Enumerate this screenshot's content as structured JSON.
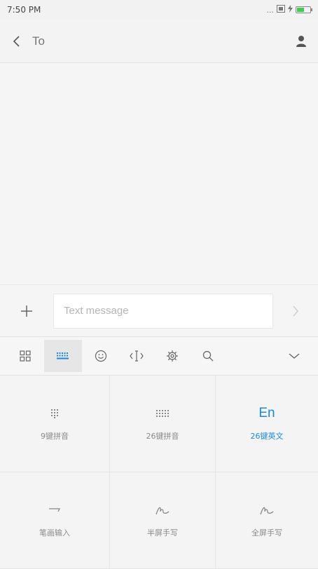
{
  "status_bar": {
    "time": "7:50 PM",
    "signal_dots": "...",
    "battery_level": 0.55,
    "battery_color": "#3ccf4e"
  },
  "header": {
    "to_placeholder": "To"
  },
  "compose": {
    "placeholder": "Text message"
  },
  "ime_toolbar": {
    "buttons": [
      "grid-icon",
      "keyboard-icon",
      "emoji-icon",
      "cursor-icon",
      "settings-icon",
      "search-icon"
    ],
    "active": "keyboard-icon"
  },
  "input_modes": [
    {
      "label": "9键拼音",
      "icon": "nine-key-icon"
    },
    {
      "label": "26键拼音",
      "icon": "qwerty-icon"
    },
    {
      "label": "26键英文",
      "icon_text": "En",
      "selected": true
    },
    {
      "label": "笔画输入",
      "icon": "stroke-icon"
    },
    {
      "label": "半屏手写",
      "icon": "handwriting-icon"
    },
    {
      "label": "全屏手写",
      "icon": "handwriting-icon"
    }
  ],
  "colors": {
    "accent": "#1e88d6",
    "background": "#f5f5f5"
  }
}
